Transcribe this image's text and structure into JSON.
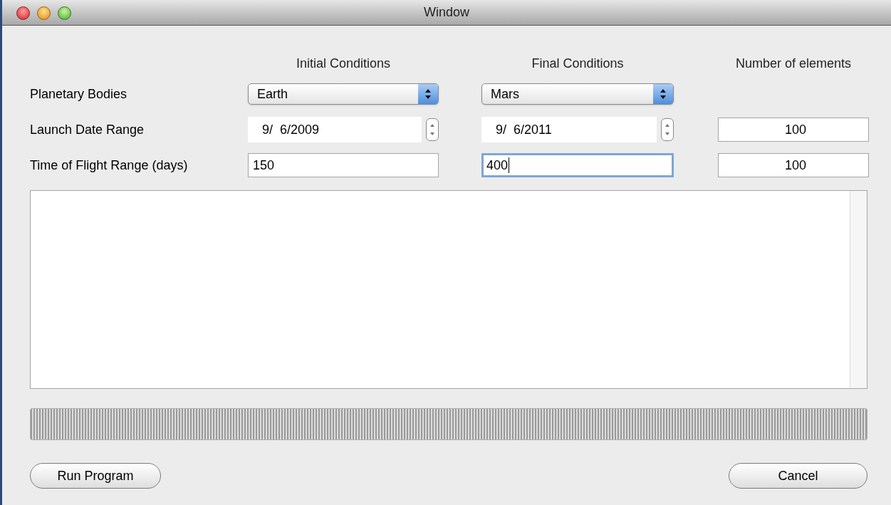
{
  "window": {
    "title": "Window"
  },
  "headers": [
    "Initial Conditions",
    "Final Conditions",
    "Number of elements"
  ],
  "rows": [
    {
      "label": "Planetary Bodies",
      "cells": [
        {
          "kind": "select",
          "value": "Earth"
        },
        {
          "kind": "select",
          "value": "Mars"
        }
      ]
    },
    {
      "label": "Launch Date Range",
      "cells": [
        {
          "kind": "date",
          "value": "9/  6/2009"
        },
        {
          "kind": "date",
          "value": "9/  6/2011"
        },
        {
          "kind": "number",
          "value": "100",
          "focused": false
        }
      ]
    },
    {
      "label": "Time of Flight Range (days)",
      "cells": [
        {
          "kind": "text",
          "value": "150",
          "focused": false
        },
        {
          "kind": "text",
          "value": "400",
          "focused": true
        },
        {
          "kind": "number",
          "value": "100",
          "focused": false
        }
      ]
    }
  ],
  "progress": {
    "indeterminate": true
  },
  "buttons": [
    "Run Program",
    "Cancel"
  ]
}
